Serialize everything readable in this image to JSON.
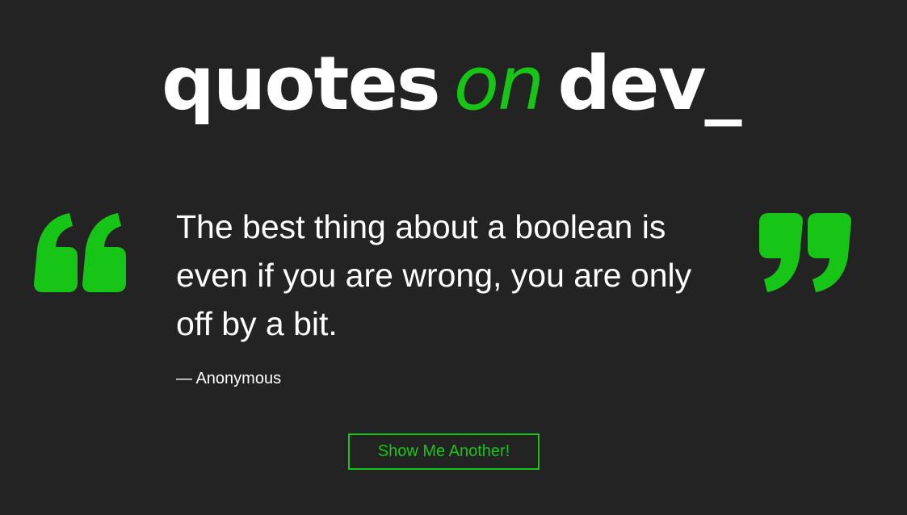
{
  "header": {
    "logo_part1": "quotes",
    "logo_part2": "on",
    "logo_part3": "dev_"
  },
  "quote": {
    "text": "The best thing about a boolean is even if you are wrong, you are only off by a bit.",
    "author": "— Anonymous"
  },
  "actions": {
    "another_label": "Show Me Another!"
  },
  "icons": {
    "open_quote": "open-quote-icon",
    "close_quote": "close-quote-icon"
  },
  "colors": {
    "background": "#232323",
    "accent": "#17c517",
    "text": "#ffffff"
  }
}
